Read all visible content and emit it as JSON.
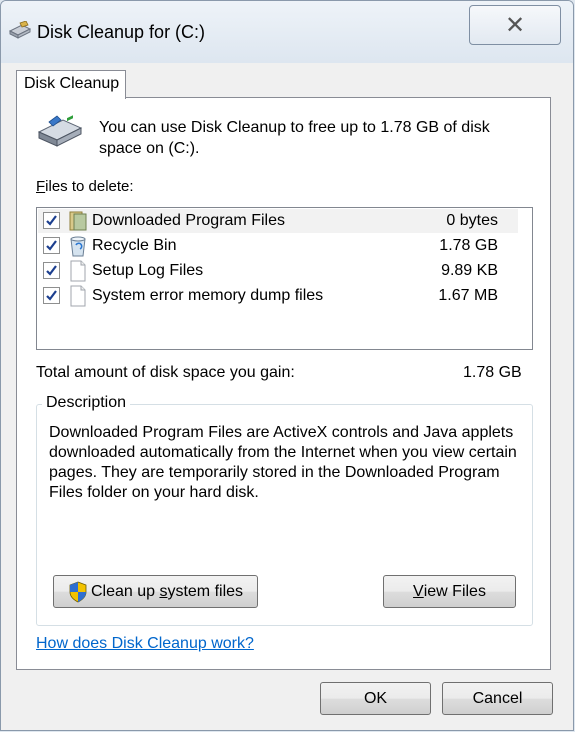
{
  "window": {
    "title": "Disk Cleanup for  (C:)",
    "close_glyph": "✕",
    "title_icon": "disk-cleanup-icon"
  },
  "tab": {
    "label": "Disk Cleanup"
  },
  "intro": {
    "text": "You can use Disk Cleanup to free up to 1.78 GB of disk space on  (C:).",
    "icon": "drive-icon"
  },
  "files_label": {
    "accel": "F",
    "rest": "iles to delete:"
  },
  "files": [
    {
      "name": "Downloaded Program Files",
      "size": "0 bytes",
      "checked": true,
      "icon": "folder-icon",
      "selected": true
    },
    {
      "name": "Recycle Bin",
      "size": "1.78 GB",
      "checked": true,
      "icon": "recycle-bin-icon",
      "selected": false
    },
    {
      "name": "Setup Log Files",
      "size": "9.89 KB",
      "checked": true,
      "icon": "document-icon",
      "selected": false
    },
    {
      "name": "System error memory dump files",
      "size": "1.67 MB",
      "checked": true,
      "icon": "document-icon",
      "selected": false
    }
  ],
  "total": {
    "label": "Total amount of disk space you gain:",
    "value": "1.78 GB"
  },
  "description": {
    "legend": "Description",
    "text": "Downloaded Program Files are ActiveX controls and Java applets downloaded automatically from the Internet when you view certain pages. They are temporarily stored in the Downloaded Program Files folder on your hard disk."
  },
  "buttons": {
    "clean_pre": "Clean up ",
    "clean_accel": "s",
    "clean_post": "ystem files",
    "view_accel": "V",
    "view_rest": "iew Files",
    "ok": "OK",
    "cancel": "Cancel"
  },
  "help_link": "How does Disk Cleanup work?"
}
